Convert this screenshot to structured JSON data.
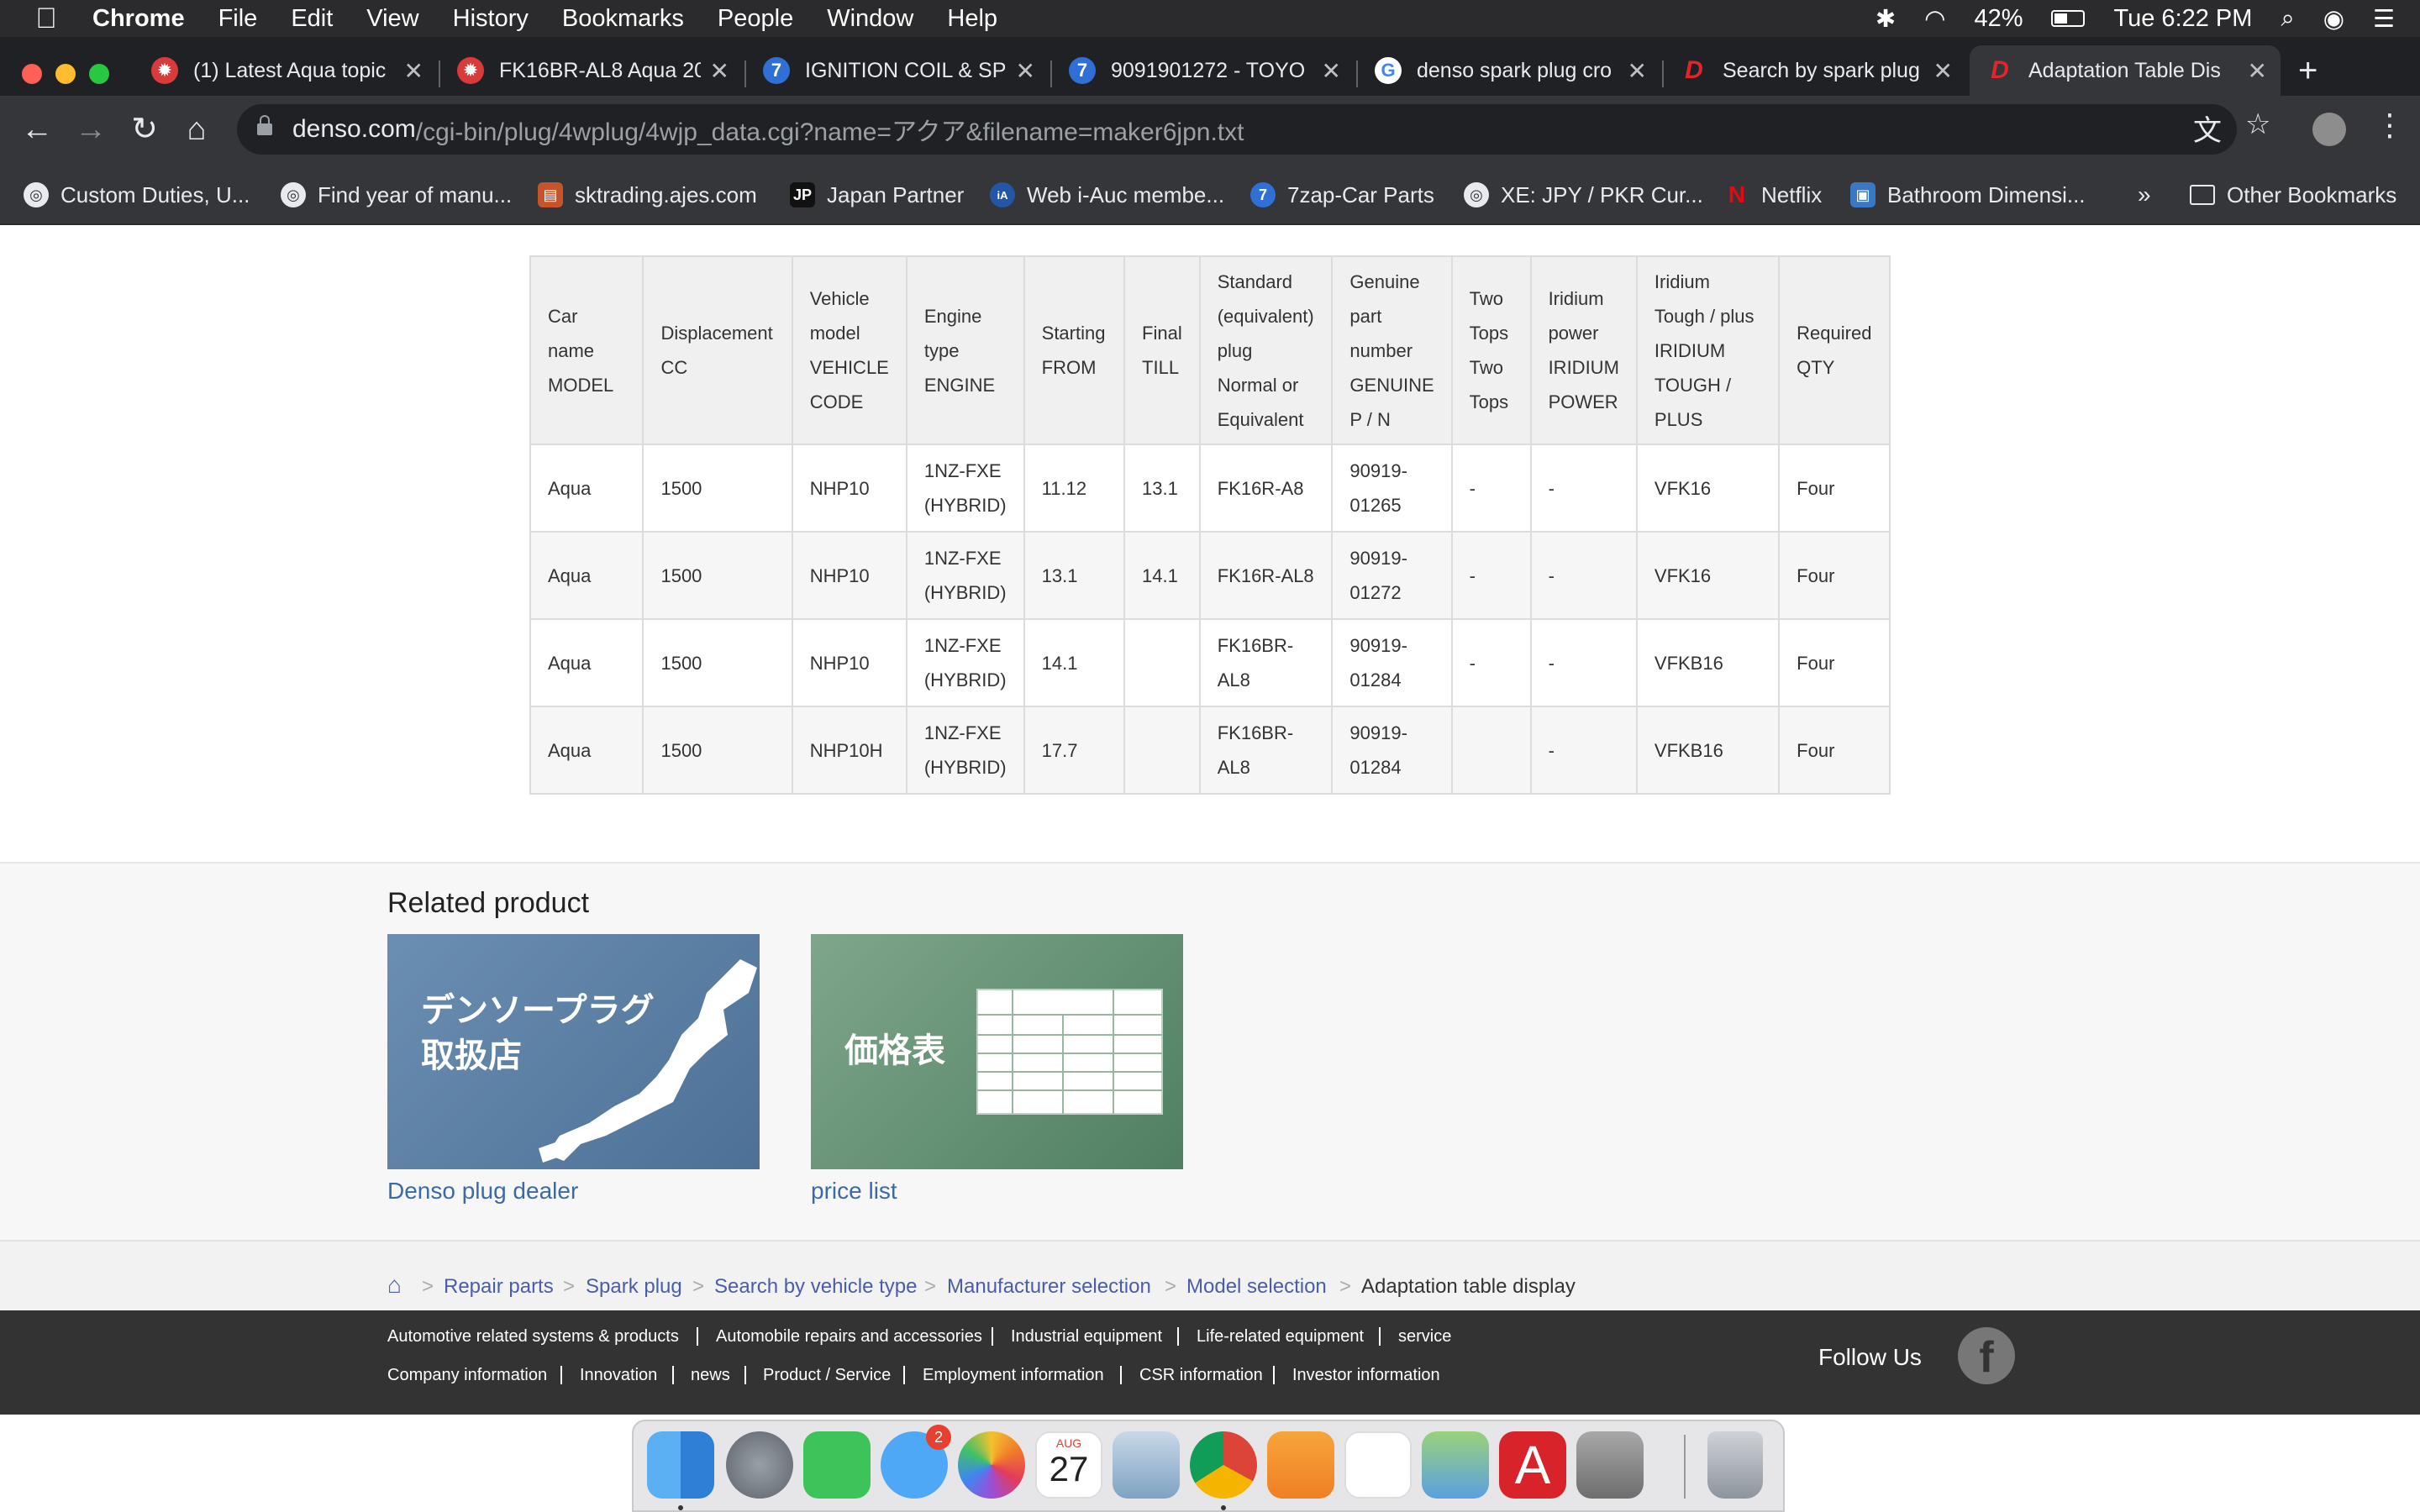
{
  "menubar": {
    "items": [
      "Chrome",
      "File",
      "Edit",
      "View",
      "History",
      "Bookmarks",
      "People",
      "Window",
      "Help"
    ],
    "battery": "42%",
    "clock": "Tue 6:22 PM"
  },
  "tabs": [
    {
      "title": "(1) Latest Aqua topic",
      "icon": "red-wheel-icon"
    },
    {
      "title": "FK16BR-AL8 Aqua 20",
      "icon": "red-wheel-icon"
    },
    {
      "title": "IGNITION COIL & SP",
      "icon": "seven-zap-icon"
    },
    {
      "title": "9091901272 - TOYO",
      "icon": "seven-zap-icon"
    },
    {
      "title": "denso spark plug cro",
      "icon": "google-icon"
    },
    {
      "title": "Search by spark plug",
      "icon": "denso-icon"
    },
    {
      "title": "Adaptation Table Dis",
      "icon": "denso-icon"
    }
  ],
  "address": {
    "host": "denso.com",
    "path": "/cgi-bin/plug/4wplug/4wjp_data.cgi?name=アクア&filename=maker6jpn.txt"
  },
  "bookmarks": [
    "Custom Duties, U...",
    "Find year of manu...",
    "sktrading.ajes.com",
    "Japan Partner",
    "Web i-Auc membe...",
    "7zap-Car Parts",
    "XE: JPY / PKR Cur...",
    "Netflix",
    "Bathroom Dimensi..."
  ],
  "bookmarks_more": "»",
  "other_bookmarks": "Other Bookmarks",
  "table": {
    "headers": [
      [
        "Car name",
        "MODEL"
      ],
      [
        "Displacement",
        "CC"
      ],
      [
        "Vehicle",
        "model",
        "VEHICLE",
        "CODE"
      ],
      [
        "Engine",
        "type",
        "ENGINE"
      ],
      [
        "Starting",
        "FROM"
      ],
      [
        "Final",
        "TILL"
      ],
      [
        "Standard",
        "(equivalent)",
        "plug",
        "Normal or",
        "Equivalent"
      ],
      [
        "Genuine",
        "part",
        "number",
        "GENUINE",
        "P / N"
      ],
      [
        "Two",
        "Tops",
        "Two",
        "Tops"
      ],
      [
        "Iridium",
        "power",
        "IRIDIUM",
        "POWER"
      ],
      [
        "Iridium",
        "Tough / plus",
        "IRIDIUM",
        "TOUGH / PLUS"
      ],
      [
        "Required",
        "QTY"
      ]
    ],
    "rows": [
      [
        [
          "Aqua"
        ],
        [
          "1500"
        ],
        [
          "NHP10"
        ],
        [
          "1NZ-FXE",
          "(HYBRID)"
        ],
        [
          "11.12"
        ],
        [
          "13.1"
        ],
        [
          "FK16R-A8"
        ],
        [
          "90919-",
          "01265"
        ],
        [
          "-"
        ],
        [
          "-"
        ],
        [
          "VFK16"
        ],
        [
          "Four"
        ]
      ],
      [
        [
          "Aqua"
        ],
        [
          "1500"
        ],
        [
          "NHP10"
        ],
        [
          "1NZ-FXE",
          "(HYBRID)"
        ],
        [
          "13.1"
        ],
        [
          "14.1"
        ],
        [
          "FK16R-AL8"
        ],
        [
          "90919-",
          "01272"
        ],
        [
          "-"
        ],
        [
          "-"
        ],
        [
          "VFK16"
        ],
        [
          "Four"
        ]
      ],
      [
        [
          "Aqua"
        ],
        [
          "1500"
        ],
        [
          "NHP10"
        ],
        [
          "1NZ-FXE",
          "(HYBRID)"
        ],
        [
          "14.1"
        ],
        [],
        [
          "FK16BR-",
          "AL8"
        ],
        [
          "90919-",
          "01284"
        ],
        [
          "-"
        ],
        [
          "-"
        ],
        [
          "VFKB16"
        ],
        [
          "Four"
        ]
      ],
      [
        [
          "Aqua"
        ],
        [
          "1500"
        ],
        [
          "NHP10H"
        ],
        [
          "1NZ-FXE",
          "(HYBRID)"
        ],
        [
          "17.7"
        ],
        [],
        [
          "FK16BR-",
          "AL8"
        ],
        [
          "90919-",
          "01284"
        ],
        [],
        [
          "-"
        ],
        [
          "VFKB16"
        ],
        [
          "Four"
        ]
      ]
    ]
  },
  "related": {
    "heading": "Related product",
    "cards": [
      {
        "caption": "Denso plug dealer",
        "image_text": [
          "デンソープラグ",
          "取扱店"
        ]
      },
      {
        "caption": "price list",
        "image_text": [
          "価格表"
        ]
      }
    ]
  },
  "breadcrumb": [
    "Repair parts",
    "Spark plug",
    "Search by vehicle type",
    "Manufacturer selection",
    "Model selection",
    "Adaptation table display"
  ],
  "footer": {
    "row1": [
      "Automotive related systems & products",
      "Automobile repairs and accessories",
      "Industrial equipment",
      "Life-related equipment",
      "service"
    ],
    "row2": [
      "Company information",
      "Innovation",
      "news",
      "Product / Service",
      "Employment information",
      "CSR information",
      "Investor information"
    ],
    "follow": "Follow Us"
  },
  "dock": {
    "messages_badge": "2",
    "calendar_month": "AUG",
    "calendar_day": "27"
  }
}
